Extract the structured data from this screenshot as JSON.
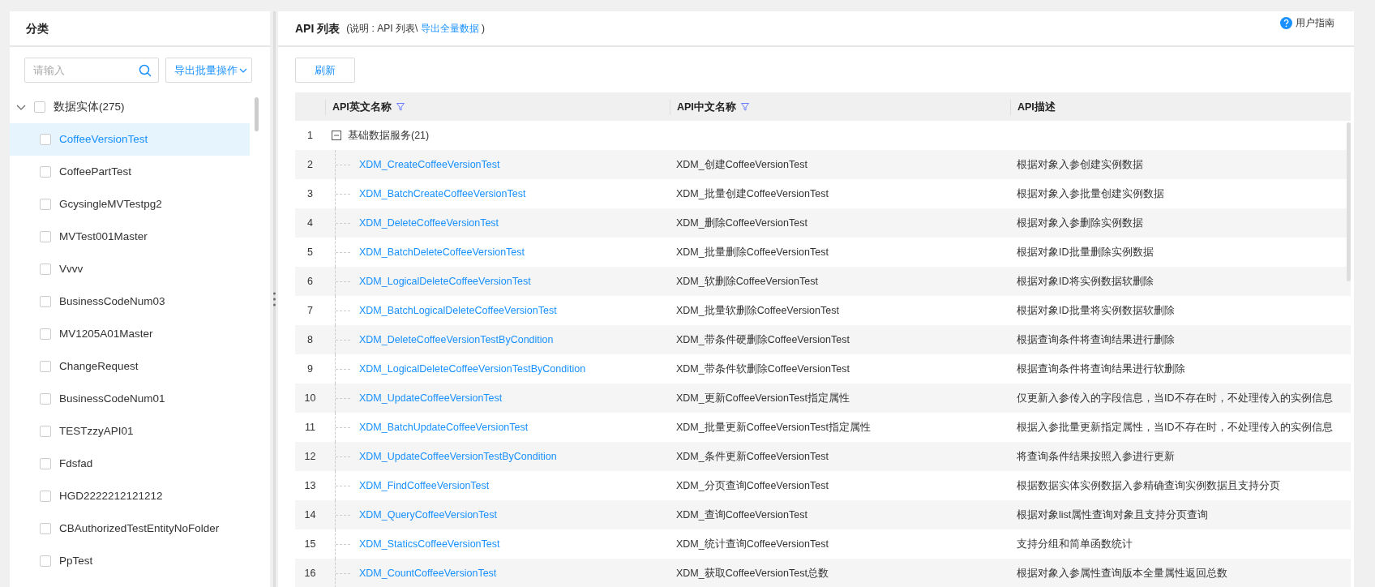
{
  "sidebar": {
    "title": "分类",
    "search": {
      "placeholder": "请输入"
    },
    "export_button": "导出批量操作",
    "tree": [
      {
        "label": "数据实体(275)",
        "checked": false,
        "expanded": true,
        "selected": false,
        "children": [
          {
            "label": "CoffeeVersionTest",
            "checked": false,
            "selected": true
          },
          {
            "label": "CoffeePartTest",
            "checked": false,
            "selected": false
          },
          {
            "label": "GcysingleMVTestpg2",
            "checked": false,
            "selected": false
          },
          {
            "label": "MVTest001Master",
            "checked": false,
            "selected": false
          },
          {
            "label": "Vvvv",
            "checked": false,
            "selected": false
          },
          {
            "label": "BusinessCodeNum03",
            "checked": false,
            "selected": false
          },
          {
            "label": "MV1205A01Master",
            "checked": false,
            "selected": false
          },
          {
            "label": "ChangeRequest",
            "checked": false,
            "selected": false
          },
          {
            "label": "BusinessCodeNum01",
            "checked": false,
            "selected": false
          },
          {
            "label": "TESTzzyAPI01",
            "checked": false,
            "selected": false
          },
          {
            "label": "Fdsfad",
            "checked": false,
            "selected": false
          },
          {
            "label": "HGD2222212121212",
            "checked": false,
            "selected": false
          },
          {
            "label": "CBAuthorizedTestEntityNoFolder",
            "checked": false,
            "selected": false
          },
          {
            "label": "PpTest",
            "checked": false,
            "selected": false
          }
        ]
      }
    ]
  },
  "main": {
    "title": "API 列表",
    "note": "(说明 : API 列表\\",
    "note_link": "导出全量数据",
    "note_end": ")",
    "help": "用户指南",
    "refresh_button": "刷新",
    "table": {
      "columns": [
        {
          "label": "API英文名称",
          "filter": true
        },
        {
          "label": "API中文名称",
          "filter": true
        },
        {
          "label": "API描述",
          "filter": false
        }
      ],
      "rows": [
        {
          "kind": "group",
          "index": "1",
          "label": "基础数据服务(21)",
          "expanded": true
        },
        {
          "kind": "api",
          "index": "2",
          "name": "XDM_CreateCoffeeVersionTest",
          "name_cn": "XDM_创建CoffeeVersionTest",
          "description": "根据对象入参创建实例数据"
        },
        {
          "kind": "api",
          "index": "3",
          "name": "XDM_BatchCreateCoffeeVersionTest",
          "name_cn": "XDM_批量创建CoffeeVersionTest",
          "description": "根据对象入参批量创建实例数据"
        },
        {
          "kind": "api",
          "index": "4",
          "name": "XDM_DeleteCoffeeVersionTest",
          "name_cn": "XDM_删除CoffeeVersionTest",
          "description": "根据对象入参删除实例数据"
        },
        {
          "kind": "api",
          "index": "5",
          "name": "XDM_BatchDeleteCoffeeVersionTest",
          "name_cn": "XDM_批量删除CoffeeVersionTest",
          "description": "根据对象ID批量删除实例数据"
        },
        {
          "kind": "api",
          "index": "6",
          "name": "XDM_LogicalDeleteCoffeeVersionTest",
          "name_cn": "XDM_软删除CoffeeVersionTest",
          "description": "根据对象ID将实例数据软删除"
        },
        {
          "kind": "api",
          "index": "7",
          "name": "XDM_BatchLogicalDeleteCoffeeVersionTest",
          "name_cn": "XDM_批量软删除CoffeeVersionTest",
          "description": "根据对象ID批量将实例数据软删除"
        },
        {
          "kind": "api",
          "index": "8",
          "name": "XDM_DeleteCoffeeVersionTestByCondition",
          "name_cn": "XDM_带条件硬删除CoffeeVersionTest",
          "description": "根据查询条件将查询结果进行删除"
        },
        {
          "kind": "api",
          "index": "9",
          "name": "XDM_LogicalDeleteCoffeeVersionTestByCondition",
          "name_cn": "XDM_带条件软删除CoffeeVersionTest",
          "description": "根据查询条件将查询结果进行软删除"
        },
        {
          "kind": "api",
          "index": "10",
          "name": "XDM_UpdateCoffeeVersionTest",
          "name_cn": "XDM_更新CoffeeVersionTest指定属性",
          "description": "仅更新入参传入的字段信息，当ID不存在时，不处理传入的实例信息"
        },
        {
          "kind": "api",
          "index": "11",
          "name": "XDM_BatchUpdateCoffeeVersionTest",
          "name_cn": "XDM_批量更新CoffeeVersionTest指定属性",
          "description": "根据入参批量更新指定属性，当ID不存在时，不处理传入的实例信息"
        },
        {
          "kind": "api",
          "index": "12",
          "name": "XDM_UpdateCoffeeVersionTestByCondition",
          "name_cn": "XDM_条件更新CoffeeVersionTest",
          "description": "将查询条件结果按照入参进行更新"
        },
        {
          "kind": "api",
          "index": "13",
          "name": "XDM_FindCoffeeVersionTest",
          "name_cn": "XDM_分页查询CoffeeVersionTest",
          "description": "根据数据实体实例数据入参精确查询实例数据且支持分页"
        },
        {
          "kind": "api",
          "index": "14",
          "name": "XDM_QueryCoffeeVersionTest",
          "name_cn": "XDM_查询CoffeeVersionTest",
          "description": "根据对象list属性查询对象且支持分页查询"
        },
        {
          "kind": "api",
          "index": "15",
          "name": "XDM_StaticsCoffeeVersionTest",
          "name_cn": "XDM_统计查询CoffeeVersionTest",
          "description": "支持分组和简单函数统计"
        },
        {
          "kind": "api",
          "index": "16",
          "name": "XDM_CountCoffeeVersionTest",
          "name_cn": "XDM_获取CoffeeVersionTest总数",
          "description": "根据对象入参属性查询版本全量属性返回总数"
        }
      ]
    }
  }
}
